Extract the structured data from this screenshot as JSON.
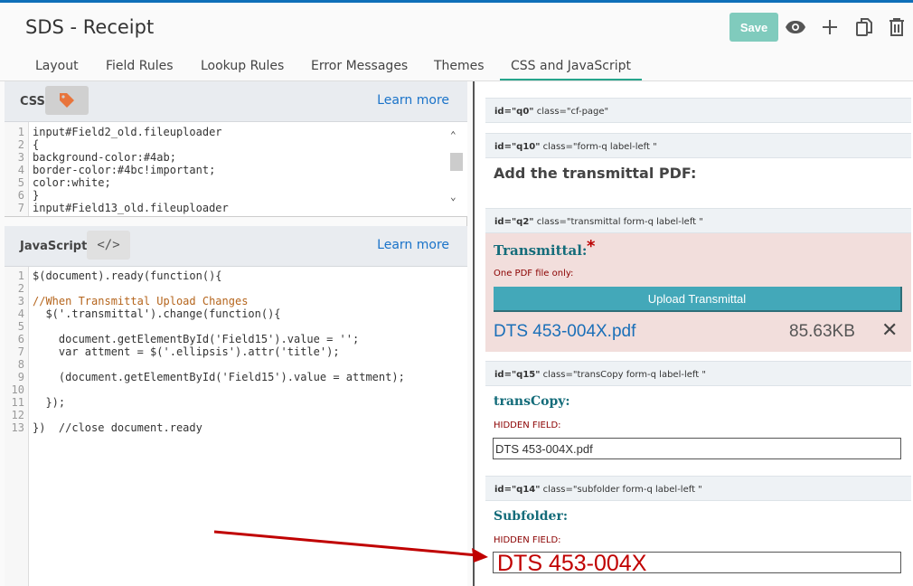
{
  "header": {
    "title": "SDS - Receipt",
    "save_label": "Save"
  },
  "tabs": [
    "Layout",
    "Field Rules",
    "Lookup Rules",
    "Error Messages",
    "Themes",
    "CSS and JavaScript"
  ],
  "css_panel": {
    "label": "CSS",
    "learn_more": "Learn more",
    "lines": [
      "input#Field2_old.fileuploader",
      "{",
      "background-color:#4ab;",
      "border-color:#4bc!important;",
      "color:white;",
      "}",
      "input#Field13_old.fileuploader"
    ]
  },
  "js_panel": {
    "label": "JavaScript",
    "learn_more": "Learn more",
    "lines": [
      "$(document).ready(function(){",
      "",
      "//When Transmittal Upload Changes",
      "  $('.transmittal').change(function(){",
      "",
      "    document.getElementById('Field15').value = '';",
      "    var attment = $('.ellipsis').attr('title');",
      "",
      "    (document.getElementById('Field15').value = attment);",
      "",
      "  });",
      "",
      "})  //close document.ready"
    ]
  },
  "preview": {
    "q0": {
      "id": "id=\"q0\"",
      "cls": "class=\"cf-page\""
    },
    "q10": {
      "id": "id=\"q10\"",
      "cls": "class=\"form-q label-left \"",
      "heading": "Add the transmittal PDF:"
    },
    "q2": {
      "id": "id=\"q2\"",
      "cls": "class=\"transmittal form-q label-left \"",
      "label": "Transmittal:",
      "required": "*",
      "hint": "One PDF file only:",
      "button": "Upload Transmittal",
      "file_name": "DTS 453-004X.pdf",
      "file_size": "85.63KB"
    },
    "q15": {
      "id": "id=\"q15\"",
      "cls": "class=\"transCopy form-q label-left \"",
      "label": "transCopy:",
      "hidden": "HIDDEN FIELD:",
      "value": "DTS 453-004X.pdf"
    },
    "q14": {
      "id": "id=\"q14\"",
      "cls": "class=\"subfolder form-q label-left \"",
      "label": "Subfolder:",
      "hidden": "HIDDEN FIELD:",
      "value": "DTS 453-004X"
    }
  }
}
